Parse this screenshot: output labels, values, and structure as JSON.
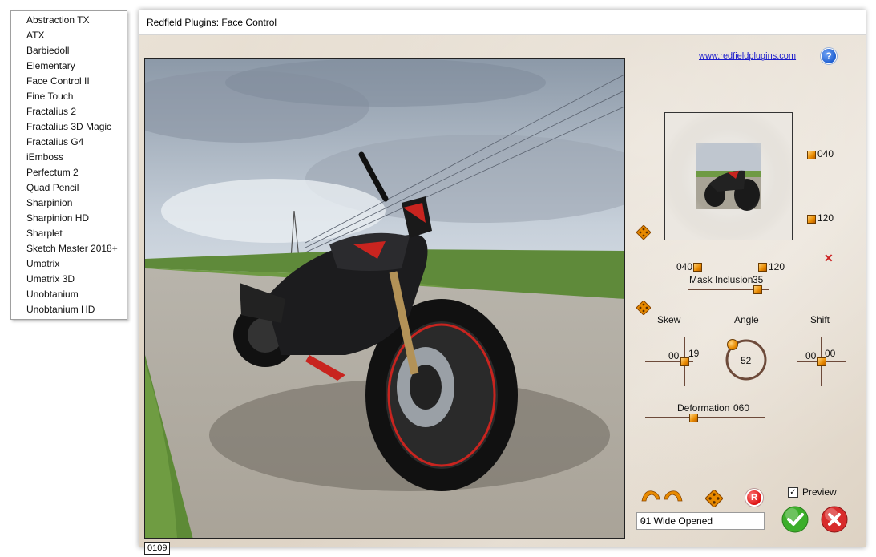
{
  "menu": {
    "items": [
      "Abstraction TX",
      "ATX",
      "Barbiedoll",
      "Elementary",
      "Face Control II",
      "Fine Touch",
      "Fractalius 2",
      "Fractalius 3D Magic",
      "Fractalius G4",
      "iEmboss",
      "Perfectum 2",
      "Quad Pencil",
      "Sharpinion",
      "Sharpinion HD",
      "Sharplet",
      "Sketch Master 2018+",
      "Umatrix",
      "Umatrix 3D",
      "Unobtanium",
      "Unobtanium HD"
    ]
  },
  "dialog": {
    "title": "Redfield Plugins: Face Control",
    "site_link": "www.redfieldplugins.com",
    "help_icon": "question-icon",
    "counter": "0109"
  },
  "thumb": {
    "right_top_value": "040",
    "right_bottom_value": "120",
    "below_left_value": "040",
    "below_right_value": "120"
  },
  "controls": {
    "mask_inclusion_label": "Mask Inclusion",
    "mask_inclusion_value": "35",
    "skew_label": "Skew",
    "skew_x": "00",
    "skew_y": "19",
    "angle_label": "Angle",
    "angle_value": "52",
    "shift_label": "Shift",
    "shift_x": "00",
    "shift_y": "00",
    "deformation_label": "Deformation",
    "deformation_value": "060"
  },
  "bottom": {
    "preview_label": "Preview",
    "preview_checked": "✓",
    "reset_label": "R",
    "preset_value": "01 Wide Opened",
    "preset_arrow": "⌄"
  },
  "colors": {
    "accent_orange": "#e88a00",
    "ok_green": "#3cae2a",
    "cancel_red": "#d82c2c",
    "link_blue": "#1a1acc"
  }
}
